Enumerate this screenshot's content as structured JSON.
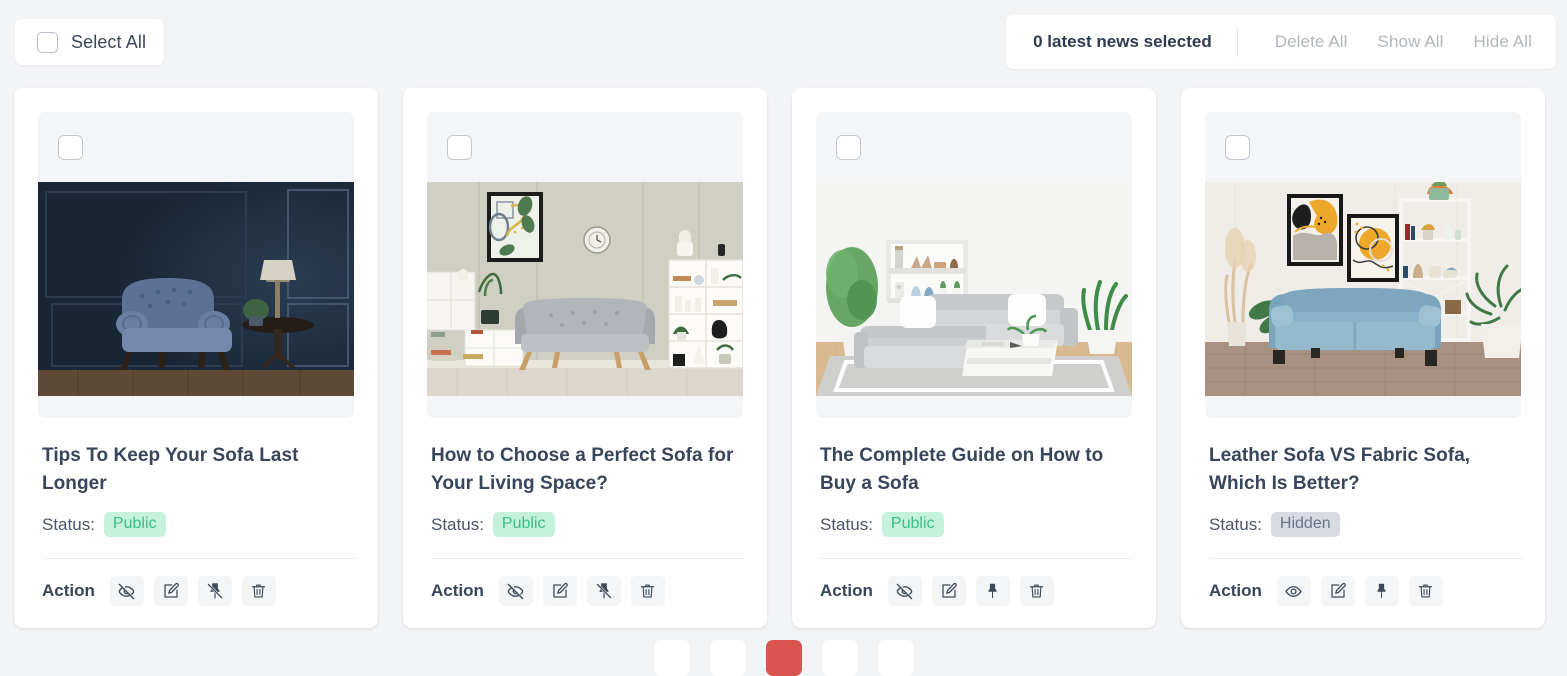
{
  "toolbar": {
    "select_all_label": "Select All",
    "select_all_checkbox_icon": "checkbox-unchecked-icon",
    "selected_count_text": "0 latest news selected",
    "delete_all_label": "Delete All",
    "show_all_label": "Show All",
    "hide_all_label": "Hide All"
  },
  "labels": {
    "status_prefix": "Status:",
    "action_prefix": "Action"
  },
  "colors": {
    "page_background": "#f3f4f6",
    "card_background": "#ffffff",
    "media_panel": "#f4f5f7",
    "title_text": "#39455a",
    "muted_text": "#b2b7be",
    "badge_public_bg": "#c6f2dd",
    "badge_public_text": "#3bbd86",
    "badge_hidden_bg": "#d9dbe2",
    "badge_hidden_text": "#6a7489",
    "pagination_active": "#d9534f"
  },
  "cards": [
    {
      "checkbox_icon": "checkbox-unchecked-icon",
      "title": "Tips To Keep Your Sofa Last Longer",
      "status": "Public",
      "status_kind": "public",
      "image_alt": "dark navy living room with blue tufted armchair and lamp",
      "image_key": "navy_armchair",
      "actions": [
        {
          "name": "hide-article-button",
          "icon": "eye-off-icon"
        },
        {
          "name": "edit-article-button",
          "icon": "edit-square-icon"
        },
        {
          "name": "unpin-article-button",
          "icon": "pin-off-icon"
        },
        {
          "name": "delete-article-button",
          "icon": "trash-icon"
        }
      ]
    },
    {
      "checkbox_icon": "checkbox-unchecked-icon",
      "title": "How to Choose a Perfect Sofa for Your Living Space?",
      "status": "Public",
      "status_kind": "public",
      "image_alt": "sage green living room with gray sofa, framed art and shelves",
      "image_key": "sage_sofa",
      "actions": [
        {
          "name": "hide-article-button",
          "icon": "eye-off-icon"
        },
        {
          "name": "edit-article-button",
          "icon": "edit-square-icon"
        },
        {
          "name": "unpin-article-button",
          "icon": "pin-off-icon"
        },
        {
          "name": "delete-article-button",
          "icon": "trash-icon"
        }
      ]
    },
    {
      "checkbox_icon": "checkbox-unchecked-icon",
      "title": "The Complete Guide on How to Buy a Sofa",
      "status": "Public",
      "status_kind": "public",
      "image_alt": "white living room with gray sectional sofa, plants and rug",
      "image_key": "white_sectional",
      "actions": [
        {
          "name": "hide-article-button",
          "icon": "eye-off-icon"
        },
        {
          "name": "edit-article-button",
          "icon": "edit-square-icon"
        },
        {
          "name": "pin-article-button",
          "icon": "pin-icon"
        },
        {
          "name": "delete-article-button",
          "icon": "trash-icon"
        }
      ]
    },
    {
      "checkbox_icon": "checkbox-unchecked-icon",
      "title": "Leather Sofa VS Fabric Sofa, Which Is Better?",
      "status": "Hidden",
      "status_kind": "hidden",
      "image_alt": "light blue sofa with abstract wall art, shelves and pampas grass",
      "image_key": "blue_sofa",
      "actions": [
        {
          "name": "show-article-button",
          "icon": "eye-icon"
        },
        {
          "name": "edit-article-button",
          "icon": "edit-square-icon"
        },
        {
          "name": "pin-article-button",
          "icon": "pin-icon"
        },
        {
          "name": "delete-article-button",
          "icon": "trash-icon"
        }
      ]
    }
  ],
  "pagination": {
    "pages": [
      "",
      "",
      "",
      "",
      ""
    ],
    "active_index": 2
  }
}
